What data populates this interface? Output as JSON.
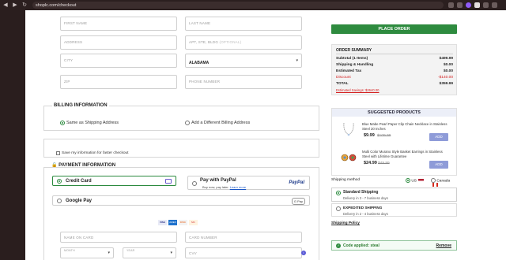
{
  "browser": {
    "url": "shoplc.com/checkout"
  },
  "shipping_form": {
    "first_name_ph": "FIRST NAME",
    "last_name_ph": "LAST NAME",
    "address_ph": "ADDRESS",
    "apt_ph": "APT, STE, BLDG",
    "apt_optional": "(OPTIONAL)",
    "city_ph": "CITY",
    "state_value": "ALABAMA",
    "zip_ph": "ZIP",
    "phone_ph": "PHONE NUMBER"
  },
  "billing": {
    "title": "BILLING INFORMATION",
    "same_label": "Same as Shipping Address",
    "different_label": "Add a Different Billing Address",
    "save_label": "Save my information for faster checkout"
  },
  "payment": {
    "title": "PAYMENT INFORMATION",
    "credit_card": "Credit Card",
    "paypal": "Pay with PayPal",
    "paypal_sub": "Buy now, pay later.",
    "paypal_learn": "Learn more",
    "paypal_logo": "PayPal",
    "google_pay": "Google Pay",
    "gpay_logo": "G Pay",
    "card_brands": [
      "VISA",
      "AMEX",
      "DISC",
      "MC"
    ],
    "name_on_card_ph": "NAME ON CARD",
    "card_number_ph": "CARD NUMBER",
    "month_ph": "MONTH",
    "year_ph": "YEAR",
    "cvv_ph": "CVV"
  },
  "summary": {
    "place_order": "PLACE ORDER",
    "title": "ORDER SUMMARY",
    "rows": [
      {
        "label": "Subtotal (1 Items)",
        "value": "$499.99"
      },
      {
        "label": "Shipping & Handling",
        "value": "$0.00"
      },
      {
        "label": "Estimated Tax",
        "value": "$0.00"
      },
      {
        "label": "Discount",
        "value": "-$140.00"
      }
    ],
    "total_label": "TOTAL",
    "total_value": "$359.99",
    "savings": "Estimated Savings: $2640.00"
  },
  "suggested": {
    "title": "SUGGESTED PRODUCTS",
    "items": [
      {
        "title": "Blue Mabe Pearl Paper Clip Chain Necklace in Stainless Steel 20 Inches",
        "price": "$9.99",
        "old_price": "$109.99",
        "button": "ADD"
      },
      {
        "title": "Multi Color Murano Style Basket Earrings in Stainless Steel with Lifetime Guarantee",
        "price": "$24.99",
        "old_price": "$49.99",
        "button": "ADD"
      }
    ]
  },
  "shipping": {
    "method_label": "Shipping method",
    "us_label": "US",
    "canada_label": "Canada",
    "standard_title": "Standard Shipping",
    "standard_sub": "Delivery in 3 - 7 business days",
    "expedited_title": "EXPEDITED SHIPPING",
    "expedited_sub": "Delivery in 2 - 4 business days",
    "policy": "Shipping Policy"
  },
  "code": {
    "text": "Code applied: steal",
    "remove": "Remove"
  },
  "colors": {
    "accent_green": "#2e8b3f",
    "discount_red": "#d42020",
    "add_button": "#8e9bd8"
  }
}
